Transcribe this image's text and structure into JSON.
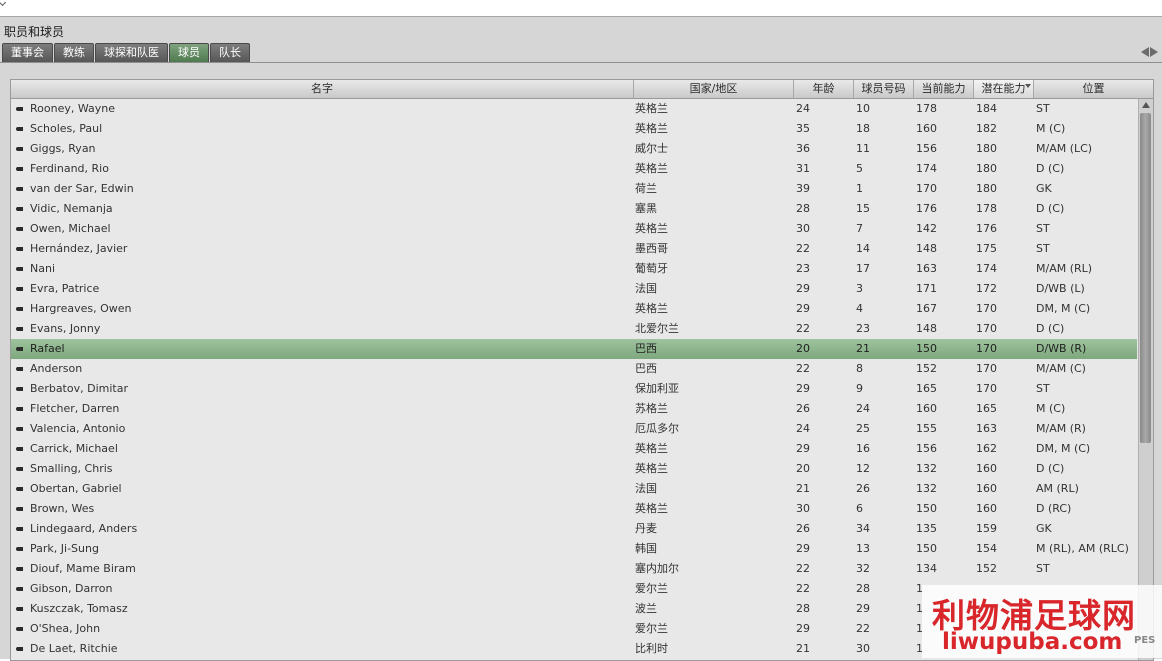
{
  "window": {
    "title": "职员和球员"
  },
  "tabs": [
    {
      "label": "董事会",
      "active": false
    },
    {
      "label": "教练",
      "active": false
    },
    {
      "label": "球探和队医",
      "active": false
    },
    {
      "label": "球员",
      "active": true
    },
    {
      "label": "队长",
      "active": false
    }
  ],
  "table": {
    "columns": [
      "名字",
      "国家/地区",
      "年龄",
      "球员号码",
      "当前能力",
      "潜在能力",
      "位置"
    ],
    "sorted_column": "潜在能力",
    "selected_row": "Rafael",
    "rows": [
      {
        "name": "Rooney, Wayne",
        "nation": "英格兰",
        "age": "24",
        "number": "10",
        "ca": "178",
        "pa": "184",
        "pos": "ST"
      },
      {
        "name": "Scholes, Paul",
        "nation": "英格兰",
        "age": "35",
        "number": "18",
        "ca": "160",
        "pa": "182",
        "pos": "M (C)"
      },
      {
        "name": "Giggs, Ryan",
        "nation": "威尔士",
        "age": "36",
        "number": "11",
        "ca": "156",
        "pa": "180",
        "pos": "M/AM (LC)"
      },
      {
        "name": "Ferdinand, Rio",
        "nation": "英格兰",
        "age": "31",
        "number": "5",
        "ca": "174",
        "pa": "180",
        "pos": "D (C)"
      },
      {
        "name": "van der Sar, Edwin",
        "nation": "荷兰",
        "age": "39",
        "number": "1",
        "ca": "170",
        "pa": "180",
        "pos": "GK"
      },
      {
        "name": "Vidic, Nemanja",
        "nation": "塞黑",
        "age": "28",
        "number": "15",
        "ca": "176",
        "pa": "178",
        "pos": "D (C)"
      },
      {
        "name": "Owen, Michael",
        "nation": "英格兰",
        "age": "30",
        "number": "7",
        "ca": "142",
        "pa": "176",
        "pos": "ST"
      },
      {
        "name": "Hernández, Javier",
        "nation": "墨西哥",
        "age": "22",
        "number": "14",
        "ca": "148",
        "pa": "175",
        "pos": "ST"
      },
      {
        "name": "Nani",
        "nation": "葡萄牙",
        "age": "23",
        "number": "17",
        "ca": "163",
        "pa": "174",
        "pos": "M/AM (RL)"
      },
      {
        "name": "Evra, Patrice",
        "nation": "法国",
        "age": "29",
        "number": "3",
        "ca": "171",
        "pa": "172",
        "pos": "D/WB (L)"
      },
      {
        "name": "Hargreaves, Owen",
        "nation": "英格兰",
        "age": "29",
        "number": "4",
        "ca": "167",
        "pa": "170",
        "pos": "DM, M (C)"
      },
      {
        "name": "Evans, Jonny",
        "nation": "北爱尔兰",
        "age": "22",
        "number": "23",
        "ca": "148",
        "pa": "170",
        "pos": "D (C)"
      },
      {
        "name": "Rafael",
        "nation": "巴西",
        "age": "20",
        "number": "21",
        "ca": "150",
        "pa": "170",
        "pos": "D/WB (R)"
      },
      {
        "name": "Anderson",
        "nation": "巴西",
        "age": "22",
        "number": "8",
        "ca": "152",
        "pa": "170",
        "pos": "M/AM (C)"
      },
      {
        "name": "Berbatov, Dimitar",
        "nation": "保加利亚",
        "age": "29",
        "number": "9",
        "ca": "165",
        "pa": "170",
        "pos": "ST"
      },
      {
        "name": "Fletcher, Darren",
        "nation": "苏格兰",
        "age": "26",
        "number": "24",
        "ca": "160",
        "pa": "165",
        "pos": "M (C)"
      },
      {
        "name": "Valencia, Antonio",
        "nation": "厄瓜多尔",
        "age": "24",
        "number": "25",
        "ca": "155",
        "pa": "163",
        "pos": "M/AM (R)"
      },
      {
        "name": "Carrick, Michael",
        "nation": "英格兰",
        "age": "29",
        "number": "16",
        "ca": "156",
        "pa": "162",
        "pos": "DM, M (C)"
      },
      {
        "name": "Smalling, Chris",
        "nation": "英格兰",
        "age": "20",
        "number": "12",
        "ca": "132",
        "pa": "160",
        "pos": "D (C)"
      },
      {
        "name": "Obertan, Gabriel",
        "nation": "法国",
        "age": "21",
        "number": "26",
        "ca": "132",
        "pa": "160",
        "pos": "AM (RL)"
      },
      {
        "name": "Brown, Wes",
        "nation": "英格兰",
        "age": "30",
        "number": "6",
        "ca": "150",
        "pa": "160",
        "pos": "D (RC)"
      },
      {
        "name": "Lindegaard, Anders",
        "nation": "丹麦",
        "age": "26",
        "number": "34",
        "ca": "135",
        "pa": "159",
        "pos": "GK"
      },
      {
        "name": "Park, Ji-Sung",
        "nation": "韩国",
        "age": "29",
        "number": "13",
        "ca": "150",
        "pa": "154",
        "pos": "M (RL), AM (RLC)"
      },
      {
        "name": "Diouf, Mame Biram",
        "nation": "塞内加尔",
        "age": "22",
        "number": "32",
        "ca": "134",
        "pa": "152",
        "pos": "ST"
      },
      {
        "name": "Gibson, Darron",
        "nation": "爱尔兰",
        "age": "22",
        "number": "28",
        "ca": "1",
        "pa": "",
        "pos": ""
      },
      {
        "name": "Kuszczak, Tomasz",
        "nation": "波兰",
        "age": "28",
        "number": "29",
        "ca": "1",
        "pa": "",
        "pos": ""
      },
      {
        "name": "O'Shea, John",
        "nation": "爱尔兰",
        "age": "29",
        "number": "22",
        "ca": "1",
        "pa": "",
        "pos": ""
      },
      {
        "name": "De Laet, Ritchie",
        "nation": "比利时",
        "age": "21",
        "number": "30",
        "ca": "1",
        "pa": "",
        "pos": ""
      }
    ]
  },
  "scrollbar": {
    "position": 0.0
  },
  "watermark": {
    "text": "利物浦足球网",
    "url_text": "liwupuba.com",
    "logo": "PES"
  },
  "colors": {
    "selected_row": "#8fb58f",
    "active_tab": "#5f8a5f",
    "watermark": "#d8262b"
  }
}
